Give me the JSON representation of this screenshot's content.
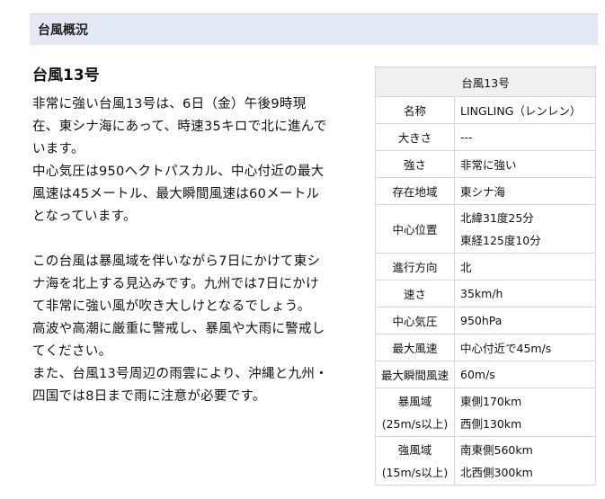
{
  "section": {
    "title": "台風概況"
  },
  "storm": {
    "heading": "台風13号",
    "paragraphs": [
      [
        "非常に強い台風13号は、6日（金）午後9時現",
        "在、東シナ海にあって、時速35キロで北に進んで",
        "います。",
        "中心気圧は950ヘクトパスカル、中心付近の最大",
        "風速は45メートル、最大瞬間風速は60メートル",
        "となっています。"
      ],
      [
        "この台風は暴風域を伴いながら7日にかけて東シ",
        "ナ海を北上する見込みです。九州では7日にかけ",
        "て非常に強い風が吹き大しけとなるでしょう。",
        "高波や高潮に厳重に警戒し、暴風や大雨に警戒し",
        "てください。",
        "また、台風13号周辺の雨雲により、沖縄と九州・",
        "四国では8日まで雨に注意が必要です。"
      ]
    ]
  },
  "table": {
    "caption": "台風13号",
    "rows": [
      {
        "label": [
          "名称"
        ],
        "value": [
          "LINGLING（レンレン）"
        ]
      },
      {
        "label": [
          "大きさ"
        ],
        "value": [
          "---"
        ]
      },
      {
        "label": [
          "強さ"
        ],
        "value": [
          "非常に強い"
        ]
      },
      {
        "label": [
          "存在地域"
        ],
        "value": [
          "東シナ海"
        ]
      },
      {
        "label": [
          "中心位置"
        ],
        "value": [
          "北緯31度25分",
          "東経125度10分"
        ]
      },
      {
        "label": [
          "進行方向"
        ],
        "value": [
          "北"
        ]
      },
      {
        "label": [
          "速さ"
        ],
        "value": [
          "35km/h"
        ]
      },
      {
        "label": [
          "中心気圧"
        ],
        "value": [
          "950hPa"
        ]
      },
      {
        "label": [
          "最大風速"
        ],
        "value": [
          "中心付近で45m/s"
        ]
      },
      {
        "label": [
          "最大瞬間風速"
        ],
        "value": [
          "60m/s"
        ]
      },
      {
        "label": [
          "暴風域",
          "(25m/s以上)"
        ],
        "value": [
          "東側170km",
          "西側130km"
        ]
      },
      {
        "label": [
          "強風域",
          "(15m/s以上)"
        ],
        "value": [
          "南東側560km",
          "北西側300km"
        ]
      }
    ]
  }
}
